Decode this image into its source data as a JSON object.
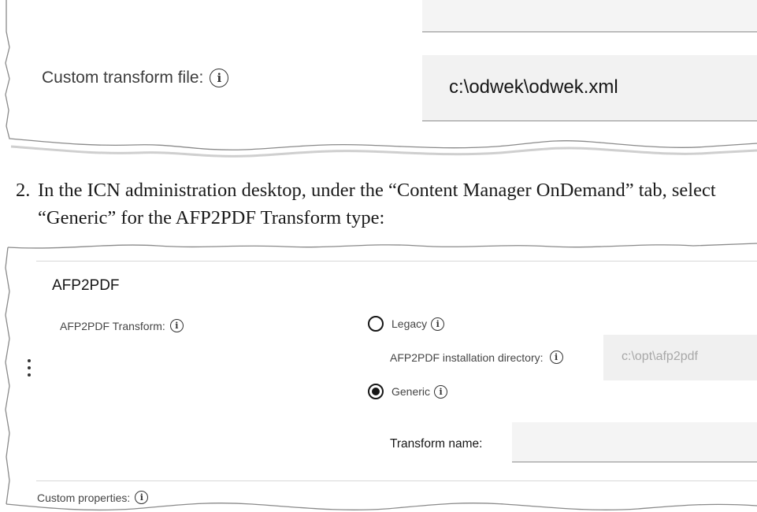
{
  "snippet1": {
    "label": "Custom transform file:",
    "info_icon": "info-icon",
    "field_value": "c:\\odwek\\odwek.xml"
  },
  "instruction": {
    "number": "2.",
    "text": "In the ICN administration desktop, under the “Content Manager OnDemand” tab, select “Generic” for the AFP2PDF Transform type:"
  },
  "snippet2": {
    "section_title": "AFP2PDF",
    "transform_label": "AFP2PDF Transform:",
    "options": {
      "legacy_label": "Legacy",
      "legacy_selected": false,
      "generic_label": "Generic",
      "generic_selected": true
    },
    "install_dir_label": "AFP2PDF installation directory:",
    "install_dir_value": "c:\\opt\\afp2pdf",
    "transform_name_label": "Transform name:",
    "transform_name_value": "",
    "custom_properties_label": "Custom properties:"
  },
  "icons": [
    "info-icon",
    "kebab-menu-icon",
    "radio-unselected-icon",
    "radio-selected-icon"
  ]
}
